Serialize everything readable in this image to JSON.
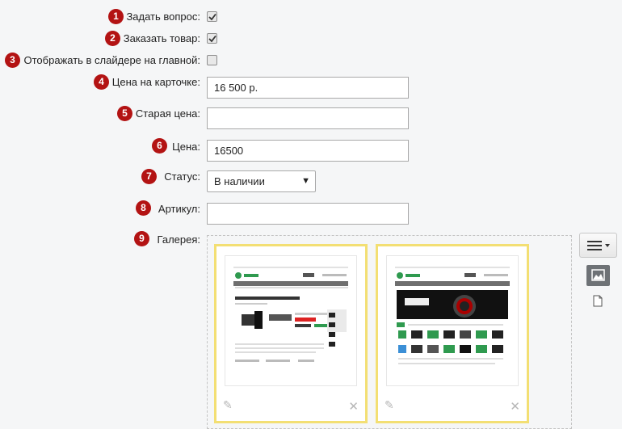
{
  "fields": {
    "ask_question": {
      "badge": "1",
      "label": "Задать вопрос:",
      "checked": true
    },
    "order_product": {
      "badge": "2",
      "label": "Заказать товар:",
      "checked": true
    },
    "show_slider": {
      "badge": "3",
      "label": "Отображать в слайдере на главной:",
      "checked": false
    },
    "card_price": {
      "badge": "4",
      "label": "Цена на карточке:",
      "value": "16 500 р."
    },
    "old_price": {
      "badge": "5",
      "label": "Старая цена:",
      "value": ""
    },
    "price": {
      "badge": "6",
      "label": "Цена:",
      "value": "16500"
    },
    "status": {
      "badge": "7",
      "label": "Статус:",
      "value": "В наличии"
    },
    "sku": {
      "badge": "8",
      "label": "Артикул:",
      "value": ""
    },
    "gallery": {
      "badge": "9",
      "label": "Галерея:"
    }
  },
  "gallery_items": [
    {
      "name": "product-page-screenshot",
      "heading": "Видеокамера Panasonic HC-V100 Red",
      "price": "17 990 руб."
    },
    {
      "name": "homepage-screenshot",
      "banner": "CANON"
    }
  ],
  "icons": {
    "menu": "hamburger-menu-icon",
    "image_view": "image-view-icon",
    "file_view": "file-view-icon",
    "edit": "pencil-icon",
    "remove": "close-icon"
  },
  "colors": {
    "badge": "#b31313",
    "thumb_border": "#f3df73",
    "brand_green": "#2f9a4f"
  }
}
